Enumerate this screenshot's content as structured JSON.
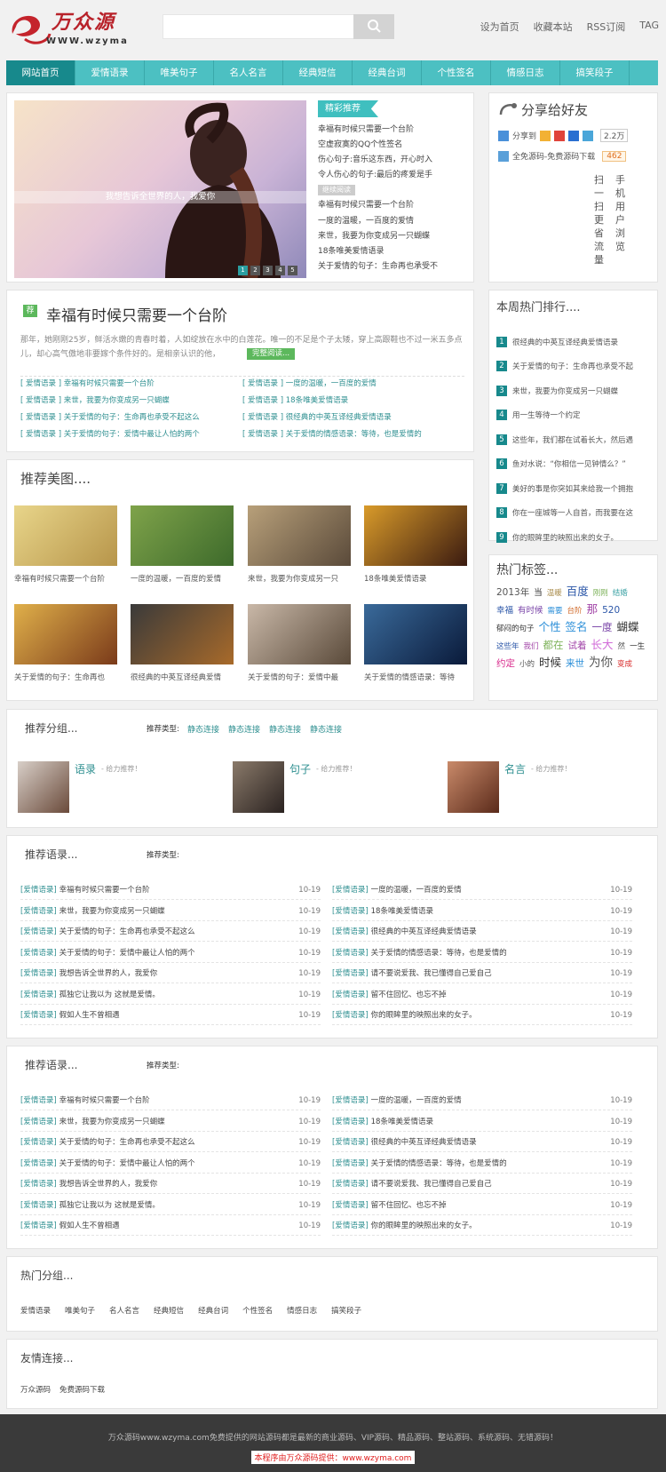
{
  "header": {
    "logo_text": "万众源",
    "logo_sub": "WWW.wzyma",
    "search_placeholder": "",
    "links": [
      "设为首页",
      "收藏本站",
      "RSS订阅",
      "TAG"
    ]
  },
  "nav": [
    "网站首页",
    "爱情语录",
    "唯美句子",
    "名人名言",
    "经典短信",
    "经典台词",
    "个性签名",
    "情感日志",
    "搞笑段子"
  ],
  "slider": {
    "caption": "我想告诉全世界的人，我爱你",
    "dots": [
      "1",
      "2",
      "3",
      "4",
      "5"
    ],
    "ribbon": "精彩推荐",
    "list": [
      "幸福有时候只需要一个台阶",
      "空虚寂寞的QQ个性签名",
      "伤心句子:音乐这东西，开心时入",
      "令人伤心的句子:最后的疼爱是手",
      "继续阅读",
      "幸福有时候只需要一个台阶",
      "一度的温暖，一百度的爱情",
      "来世，我要为你变成另一只蝴蝶",
      "18条唯美爱情语录",
      "关于爱情的句子：生命再也承受不"
    ]
  },
  "share": {
    "title": "分享给好友",
    "share_label": "分享到",
    "share_count": "2.2万",
    "source_label": "全免源码-免费源码下载",
    "source_count": "462",
    "scan_col1": [
      "扫",
      "一",
      "扫",
      "更",
      "省",
      "流",
      "量"
    ],
    "scan_col2": [
      "手",
      "机",
      "用",
      "户",
      "浏",
      "览"
    ]
  },
  "feature": {
    "badge": "荐",
    "title": "幸福有时候只需要一个台阶",
    "summary": "那年，她刚刚25岁，鲜活水嫩的青春时着，人如绽放在水中的白莲花。唯一的不足是个子太矮，穿上高跟鞋也不过一米五多点儿，却心高气傲地非要嫁个条件好的。是相亲认识的他，",
    "more": "完整阅读...",
    "rows": [
      {
        "cat": "[ 爱情语录 ]",
        "title": "幸福有时候只需要一个台阶"
      },
      {
        "cat": "[ 爱情语录 ]",
        "title": "一度的温暖，一百度的爱情"
      },
      {
        "cat": "[ 爱情语录 ]",
        "title": "来世，我要为你变成另一只蝴蝶"
      },
      {
        "cat": "[ 爱情语录 ]",
        "title": "18条唯美爱情语录"
      },
      {
        "cat": "[ 爱情语录 ]",
        "title": "关于爱情的句子：生命再也承受不起这么"
      },
      {
        "cat": "[ 爱情语录 ]",
        "title": "很经典的中英互译经典爱情语录"
      },
      {
        "cat": "[ 爱情语录 ]",
        "title": "关于爱情的句子：爱情中最让人怕的两个"
      },
      {
        "cat": "[ 爱情语录 ]",
        "title": "关于爱情的情感语录：等待，也是爱情的"
      }
    ]
  },
  "hot_rank": {
    "title": "本周热门排行....",
    "items": [
      "很经典的中英互译经典爱情语录",
      "关于爱情的句子：生命再也承受不起",
      "来世，我要为你变成另一只蝴蝶",
      "用一生等待一个约定",
      "这些年，我们都在试着长大，然后遇",
      "鱼对水说：“你相信一见钟情么？”",
      "美好的事是你突如其来给我一个拥抱",
      "你在一座城等一人自首，而我要在这",
      "你的眼眸里的映照出来的女子。"
    ]
  },
  "photos": {
    "title": "推荐美图....",
    "items": [
      "幸福有时候只需要一个台阶",
      "一度的温暖，一百度的爱情",
      "来世，我要为你变成另一只",
      "18条唯美爱情语录",
      "关于爱情的句子：生命再也",
      "很经典的中英互译经典爱情",
      "关于爱情的句子：爱情中最",
      "关于爱情的情感语录：等待"
    ]
  },
  "tags": {
    "title": "热门标签...",
    "items": [
      {
        "t": "2013年",
        "c": "#555",
        "s": 11
      },
      {
        "t": "当",
        "c": "#333",
        "s": 10
      },
      {
        "t": "温暖",
        "c": "#a88b4a",
        "s": 9
      },
      {
        "t": "百度",
        "c": "#2c57a8",
        "s": 13
      },
      {
        "t": "刚刚",
        "c": "#7fb35c",
        "s": 9
      },
      {
        "t": "结婚",
        "c": "#3aa1a3",
        "s": 9
      },
      {
        "t": "幸福",
        "c": "#2c57a8",
        "s": 10
      },
      {
        "t": "有时候",
        "c": "#7a45a8",
        "s": 10
      },
      {
        "t": "需要",
        "c": "#2c8fd8",
        "s": 9
      },
      {
        "t": "台阶",
        "c": "#d16a2a",
        "s": 9
      },
      {
        "t": "那",
        "c": "#a245a8",
        "s": 13
      },
      {
        "t": "520",
        "c": "#2c57a8",
        "s": 11
      },
      {
        "t": "郁闷的句子",
        "c": "#333",
        "s": 9
      },
      {
        "t": "个性",
        "c": "#2c8fd8",
        "s": 13
      },
      {
        "t": "签名",
        "c": "#2c8fd8",
        "s": 13
      },
      {
        "t": "一度",
        "c": "#7a45a8",
        "s": 12
      },
      {
        "t": "蝴蝶",
        "c": "#333",
        "s": 13
      },
      {
        "t": "这些年",
        "c": "#2c57a8",
        "s": 9
      },
      {
        "t": "我们",
        "c": "#a245a8",
        "s": 9
      },
      {
        "t": "都在",
        "c": "#7fb35c",
        "s": 12
      },
      {
        "t": "试着",
        "c": "#a245a8",
        "s": 11
      },
      {
        "t": "长大",
        "c": "#d16ad8",
        "s": 13
      },
      {
        "t": "然",
        "c": "#555",
        "s": 9
      },
      {
        "t": "一生",
        "c": "#333",
        "s": 9
      },
      {
        "t": "约定",
        "c": "#d8288b",
        "s": 11
      },
      {
        "t": "小的",
        "c": "#555",
        "s": 9
      },
      {
        "t": "时候",
        "c": "#333",
        "s": 13
      },
      {
        "t": "来世",
        "c": "#2c8fd8",
        "s": 11
      },
      {
        "t": "为你",
        "c": "#555",
        "s": 14
      },
      {
        "t": "变成",
        "c": "#d82828",
        "s": 9
      }
    ]
  },
  "groups": {
    "title": "推荐分组...",
    "type_label": "推荐类型:",
    "types": [
      "静态连接",
      "静态连接",
      "静态连接",
      "静态连接"
    ],
    "items": [
      {
        "name": "语录",
        "note": "- 给力推荐！"
      },
      {
        "name": "句子",
        "note": "- 给力推荐！"
      },
      {
        "name": "名言",
        "note": "- 给力推荐！"
      }
    ]
  },
  "quotes": {
    "title": "推荐语录...",
    "type_label": "推荐类型:",
    "left": [
      {
        "cat": "[爱情语录]",
        "title": "幸福有时候只需要一个台阶",
        "date": "10-19"
      },
      {
        "cat": "[爱情语录]",
        "title": "来世，我要为你变成另一只蝴蝶",
        "date": "10-19"
      },
      {
        "cat": "[爱情语录]",
        "title": "关于爱情的句子：生命再也承受不起这么",
        "date": "10-19"
      },
      {
        "cat": "[爱情语录]",
        "title": "关于爱情的句子：爱情中最让人怕的两个",
        "date": "10-19"
      },
      {
        "cat": "[爱情语录]",
        "title": "我想告诉全世界的人，我爱你",
        "date": "10-19"
      },
      {
        "cat": "[爱情语录]",
        "title": "孤独它让我以为 这就是爱情。",
        "date": "10-19"
      },
      {
        "cat": "[爱情语录]",
        "title": "假如人生不曾相遇",
        "date": "10-19"
      }
    ],
    "right": [
      {
        "cat": "[爱情语录]",
        "title": "一度的温暖，一百度的爱情",
        "date": "10-19"
      },
      {
        "cat": "[爱情语录]",
        "title": "18条唯美爱情语录",
        "date": "10-19"
      },
      {
        "cat": "[爱情语录]",
        "title": "很经典的中英互译经典爱情语录",
        "date": "10-19"
      },
      {
        "cat": "[爱情语录]",
        "title": "关于爱情的情感语录：等待，也是爱情的",
        "date": "10-19"
      },
      {
        "cat": "[爱情语录]",
        "title": "请不要说爱我、我已懂得自己爱自己",
        "date": "10-19"
      },
      {
        "cat": "[爱情语录]",
        "title": "留不住回忆、也忘不掉",
        "date": "10-19"
      },
      {
        "cat": "[爱情语录]",
        "title": "你的眼眸里的映照出来的女子。",
        "date": "10-19"
      }
    ]
  },
  "hot_groups": {
    "title": "热门分组...",
    "items": [
      "爱情语录",
      "唯美句子",
      "名人名言",
      "经典短信",
      "经典台词",
      "个性签名",
      "情感日志",
      "搞笑段子"
    ]
  },
  "friends": {
    "title": "友情连接...",
    "items": [
      "万众源码",
      "免费源码下载"
    ]
  },
  "footer": {
    "line1": "万众源码www.wzyma.com免费提供的网站源码都是最新的商业源码、VIP源码、精品源码、整站源码、系统源码、无错源码！",
    "line2": "本程序由万众源码提供：www.wzyma.com"
  },
  "colors": {
    "accent": "#4cc0c2",
    "accent_dark": "#17898c",
    "link": "#2e8f90"
  }
}
